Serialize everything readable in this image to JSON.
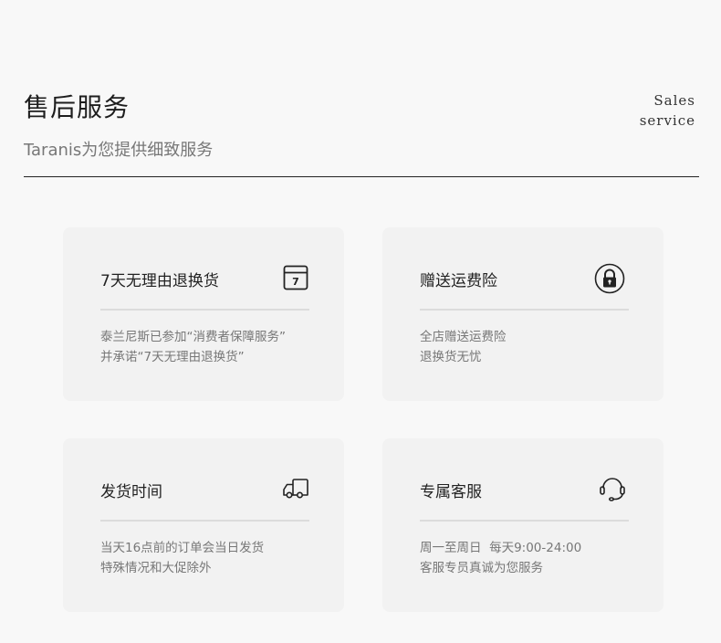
{
  "header": {
    "title": "售后服务",
    "subtitle": "Taranis为您提供细致服务",
    "en_line1": "Sales",
    "en_line2": "service"
  },
  "cards": [
    {
      "title": "7天无理由退换货",
      "icon": "calendar-7-icon",
      "icon_text": "7",
      "lines": [
        "泰兰尼斯已参加“消费者保障服务”",
        "并承诺“7天无理由退换货”"
      ]
    },
    {
      "title": "赠送运费险",
      "icon": "lock-icon",
      "lines": [
        "全店赠送运费险",
        "退换货无忧"
      ]
    },
    {
      "title": "发货时间",
      "icon": "delivery-truck-icon",
      "lines": [
        "当天16点前的订单会当日发货",
        "特殊情况和大促除外"
      ]
    },
    {
      "title": "专属客服",
      "icon": "headset-icon",
      "lines": [
        "周一至周日  每天9:00-24:00",
        "客服专员真诚为您服务"
      ]
    }
  ]
}
